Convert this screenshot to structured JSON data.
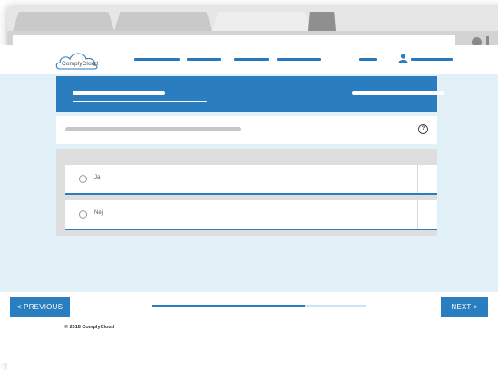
{
  "browser": {
    "tabs": [
      {
        "name": "tab-1"
      },
      {
        "name": "tab-2"
      },
      {
        "name": "tab-active"
      },
      {
        "name": "tab-new"
      }
    ]
  },
  "header": {
    "logo_text": "ComplyCloud",
    "brand_color": "#2a7dbf"
  },
  "question": {
    "options": [
      {
        "label": "Ja",
        "selected": false
      },
      {
        "label": "Nej",
        "selected": false
      }
    ]
  },
  "footer": {
    "prev_label": "< PREVIOUS",
    "next_label": "NEXT >",
    "progress": 0.71,
    "copyright": "© 2018 ComplyCloud"
  },
  "icons": {
    "help": "help-icon",
    "user": "user-icon",
    "logo": "cloud-logo-icon"
  }
}
